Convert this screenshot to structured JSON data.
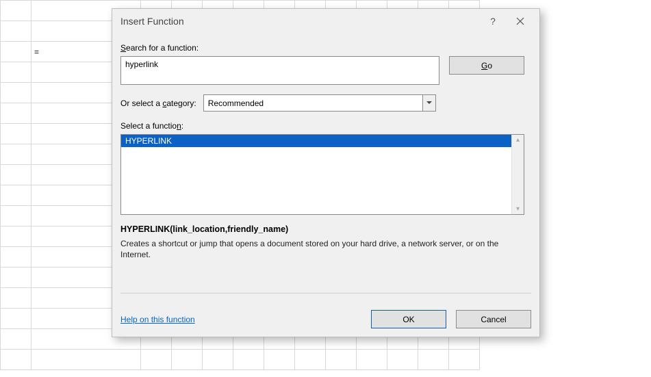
{
  "cells": {
    "b3": "="
  },
  "dialog": {
    "title": "Insert Function",
    "search_label_pre": "S",
    "search_label_rest": "earch for a function:",
    "search_value": "hyperlink",
    "go_pre": "G",
    "go_rest": "o",
    "cat_label_pre": "Or select a ",
    "cat_label_u": "c",
    "cat_label_rest": "ategory:",
    "cat_value": "Recommended",
    "select_label_pre": "Select a functio",
    "select_label_u": "n",
    "select_label_rest": ":",
    "list_item": "HYPERLINK",
    "signature": "HYPERLINK(link_location,friendly_name)",
    "description": "Creates a shortcut or jump that opens a document stored on your hard drive, a network server, or on the Internet.",
    "help_label": "Help on this function",
    "ok_label": "OK",
    "cancel_label": "Cancel"
  }
}
